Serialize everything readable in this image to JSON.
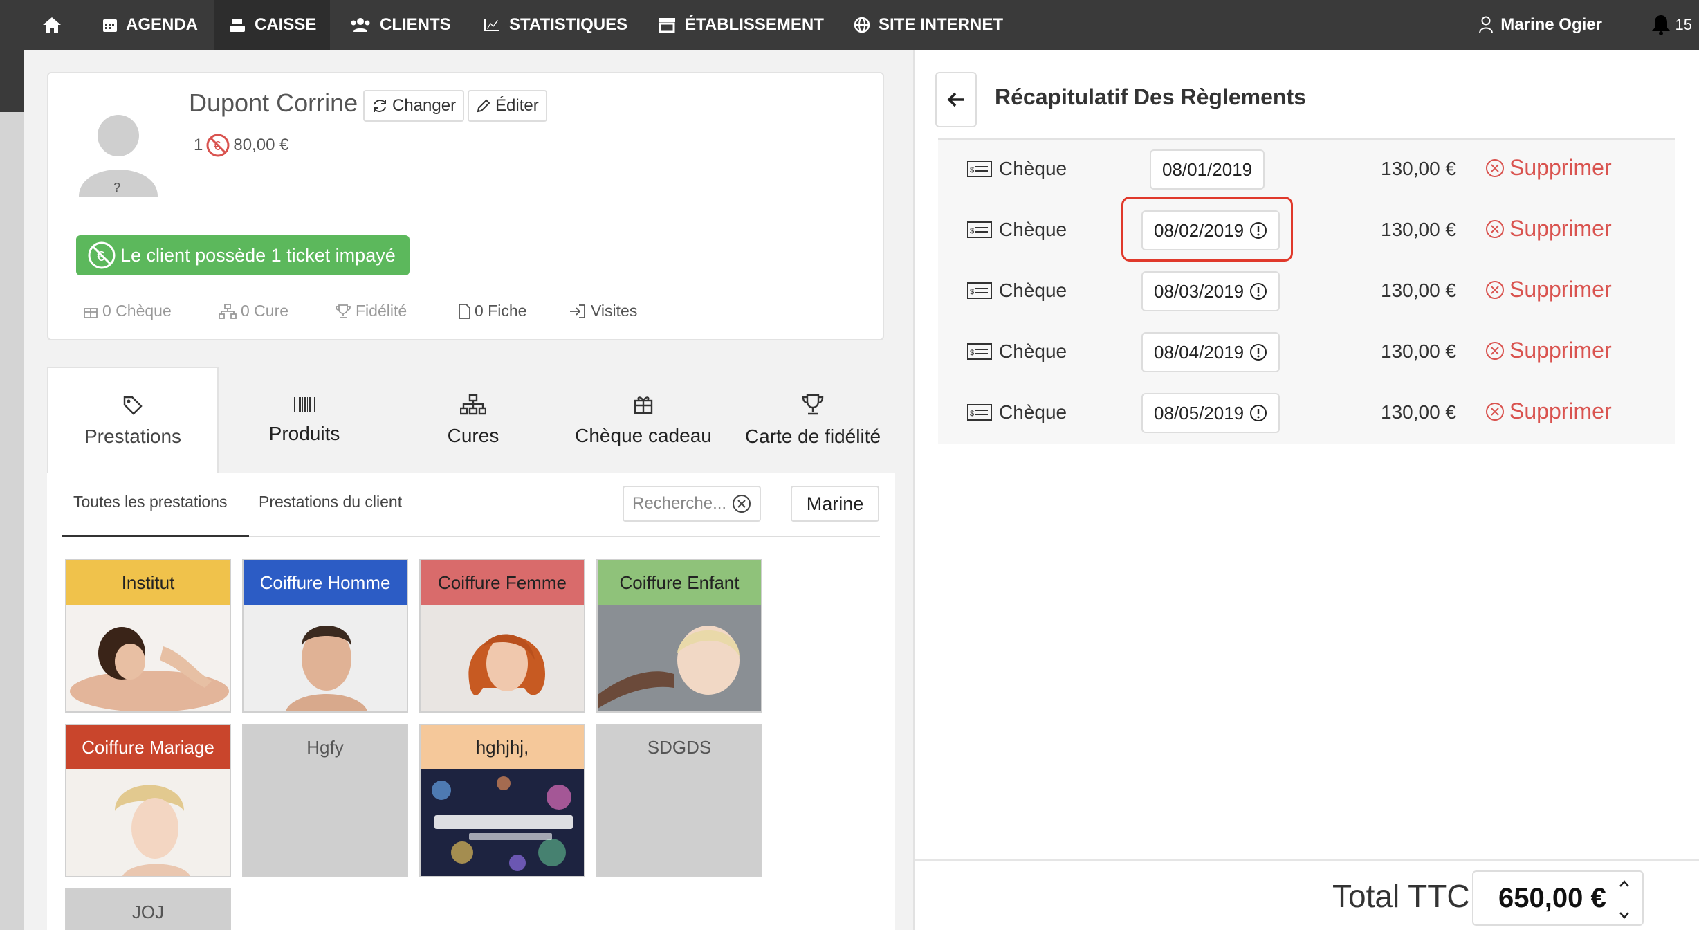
{
  "nav": {
    "items": [
      {
        "label": "AGENDA",
        "icon": "calendar-icon"
      },
      {
        "label": "CAISSE",
        "icon": "cash-register-icon"
      },
      {
        "label": "CLIENTS",
        "icon": "users-icon"
      },
      {
        "label": "STATISTIQUES",
        "icon": "chart-icon"
      },
      {
        "label": "ÉTABLISSEMENT",
        "icon": "store-icon"
      },
      {
        "label": "SITE INTERNET",
        "icon": "globe-icon"
      }
    ],
    "user_name": "Marine Ogier",
    "notifications": "15"
  },
  "client": {
    "name": "Dupont Corrine",
    "change_label": "Changer",
    "edit_label": "Éditer",
    "unpaid_count": "1",
    "unpaid_amount": "80,00 €",
    "alert": "Le client possède 1 ticket impayé",
    "stats": {
      "cheque": "0 Chèque",
      "cure": "0 Cure",
      "fidelite": "Fidélité",
      "fiche": "0 Fiche",
      "visites": "Visites"
    }
  },
  "tabs": [
    "Prestations",
    "Produits",
    "Cures",
    "Chèque cadeau",
    "Carte de fidélité"
  ],
  "subtabs": {
    "all": "Toutes les prestations",
    "client": "Prestations du client",
    "search_placeholder": "Recherche...",
    "staff": "Marine"
  },
  "categories": [
    {
      "label": "Institut",
      "color": "#f0c24b",
      "text_color": "#222"
    },
    {
      "label": "Coiffure Homme",
      "color": "#2c5cc5",
      "text_color": "#ffffff"
    },
    {
      "label": "Coiffure Femme",
      "color": "#d96b6b",
      "text_color": "#222"
    },
    {
      "label": "Coiffure Enfant",
      "color": "#8fc27a",
      "text_color": "#222"
    },
    {
      "label": "Coiffure Mariage",
      "color": "#c9452c",
      "text_color": "#ffffff"
    },
    {
      "label": "Hgfy",
      "color": "#cfcfcf",
      "text_color": "#555"
    },
    {
      "label": "hghjhj,",
      "color": "#f5c89a",
      "text_color": "#222"
    },
    {
      "label": "SDGDS",
      "color": "#cfcfcf",
      "text_color": "#555"
    },
    {
      "label": "JOJ",
      "color": "#cfcfcf",
      "text_color": "#555"
    }
  ],
  "payments": {
    "title": "Récapitulatif Des Règlements",
    "rows": [
      {
        "method": "Chèque",
        "date": "08/01/2019",
        "amount": "130,00 €",
        "delete": "Supprimer"
      },
      {
        "method": "Chèque",
        "date": "08/02/2019",
        "amount": "130,00 €",
        "delete": "Supprimer"
      },
      {
        "method": "Chèque",
        "date": "08/03/2019",
        "amount": "130,00 €",
        "delete": "Supprimer"
      },
      {
        "method": "Chèque",
        "date": "08/04/2019",
        "amount": "130,00 €",
        "delete": "Supprimer"
      },
      {
        "method": "Chèque",
        "date": "08/05/2019",
        "amount": "130,00 €",
        "delete": "Supprimer"
      }
    ]
  },
  "total": {
    "label": "Total TTC",
    "value": "650,00 €"
  },
  "colors": {
    "topbar": "#3a3a3a",
    "success": "#5cb85c",
    "danger": "#d9534f",
    "highlight": "#e0392b"
  }
}
